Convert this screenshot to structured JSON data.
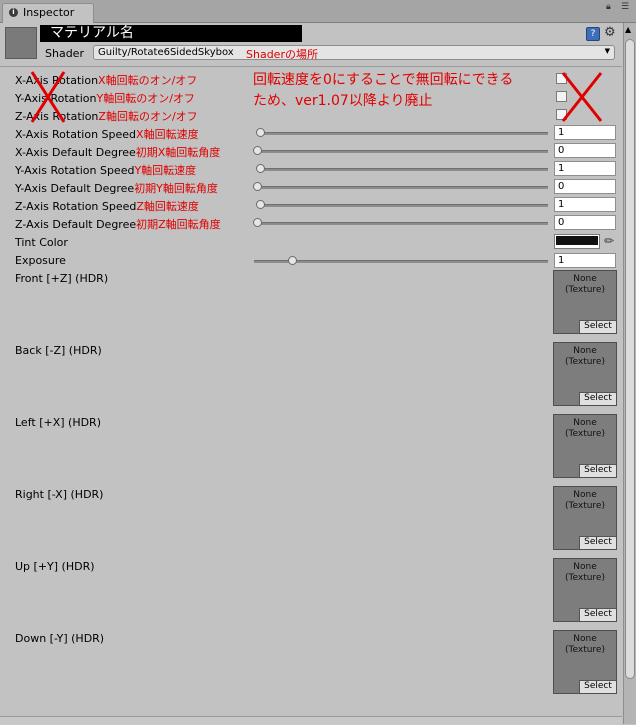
{
  "tab": {
    "title": "Inspector"
  },
  "material": {
    "name": "マテリアル名"
  },
  "shader": {
    "label": "Shader",
    "value": "Guilty/Rotate6SidedSkybox",
    "note": "Shaderの場所"
  },
  "note": {
    "line1": "回転速度を0にすることで無回転にできる",
    "line2": "ため、ver1.07以降より廃止"
  },
  "checkbox_rows": [
    {
      "label": "X-Axis Rotation",
      "note": "X軸回転のオン/オフ"
    },
    {
      "label": "Y-Axis Rotation",
      "note": "Y軸回転のオン/オフ"
    },
    {
      "label": "Z-Axis Rotation",
      "note": "Z軸回転のオン/オフ"
    }
  ],
  "slider_rows": [
    {
      "label": "X-Axis Rotation Speed",
      "note": "X軸回転速度",
      "value": "1"
    },
    {
      "label": "X-Axis Default Degree",
      "note": "初期X軸回転角度",
      "value": "0"
    },
    {
      "label": "Y-Axis Rotation Speed",
      "note": "Y軸回転速度",
      "value": "1"
    },
    {
      "label": "Y-Axis Default Degree",
      "note": "初期Y軸回転角度",
      "value": "0"
    },
    {
      "label": "Z-Axis Rotation Speed",
      "note": "Z軸回転速度",
      "value": "1"
    },
    {
      "label": "Z-Axis Default Degree",
      "note": "初期Z軸回転角度",
      "value": "0"
    }
  ],
  "tint": {
    "label": "Tint Color"
  },
  "exposure": {
    "label": "Exposure",
    "value": "1"
  },
  "textures": [
    {
      "label": "Front [+Z]   (HDR)",
      "none": "None",
      "type": "(Texture)",
      "select": "Select"
    },
    {
      "label": "Back [-Z]   (HDR)",
      "none": "None",
      "type": "(Texture)",
      "select": "Select"
    },
    {
      "label": "Left [+X]   (HDR)",
      "none": "None",
      "type": "(Texture)",
      "select": "Select"
    },
    {
      "label": "Right [-X]   (HDR)",
      "none": "None",
      "type": "(Texture)",
      "select": "Select"
    },
    {
      "label": "Up [+Y]   (HDR)",
      "none": "None",
      "type": "(Texture)",
      "select": "Select"
    },
    {
      "label": "Down [-Y]   (HDR)",
      "none": "None",
      "type": "(Texture)",
      "select": "Select"
    }
  ],
  "colors": {
    "annotation": "#e00000",
    "background": "#c2c2c2"
  },
  "icons": [
    "info-icon",
    "lock-icon",
    "menu-icon",
    "help-icon",
    "gear-icon",
    "eyedropper-icon"
  ]
}
